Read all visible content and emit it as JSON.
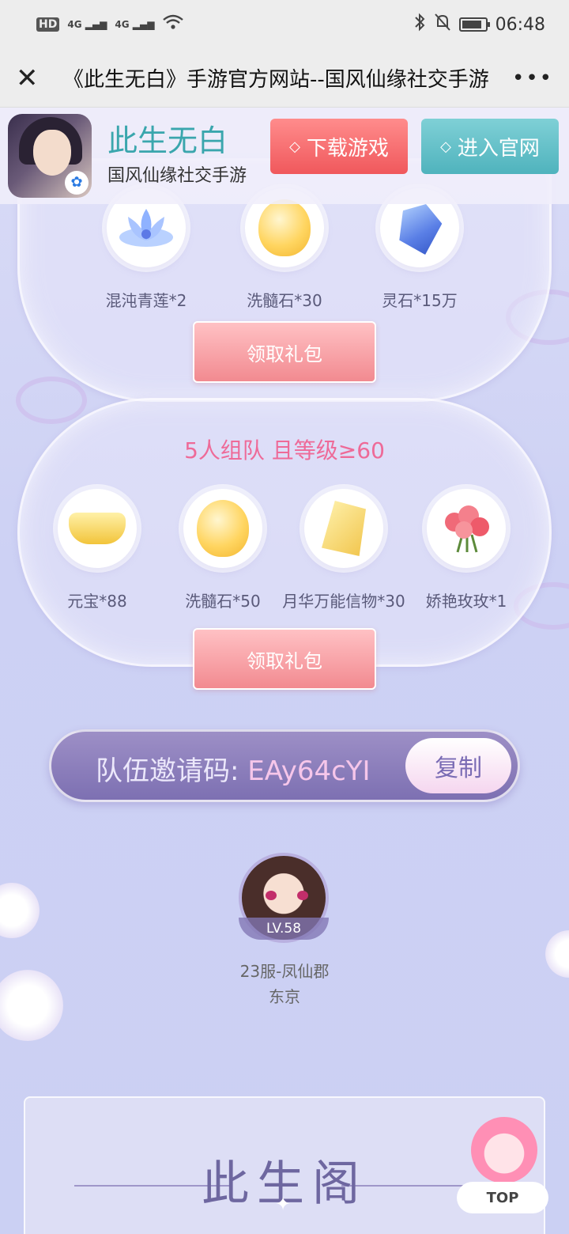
{
  "status_bar": {
    "hd": "HD",
    "net1": "4G",
    "net2": "4G",
    "time": "06:48",
    "battery_level": 0.85
  },
  "browser": {
    "title": "《此生无白》手游官方网站--国风仙缘社交手游",
    "close_glyph": "✕",
    "more_glyph": "•••"
  },
  "banner": {
    "app_name": "此生无白",
    "app_subtitle": "国风仙缘社交手游",
    "download_label": "下载游戏",
    "official_label": "进入官网",
    "diamond_glyph": "◇"
  },
  "panel1": {
    "items": [
      {
        "label": "混沌青莲*2",
        "icon": "blue-lotus-icon"
      },
      {
        "label": "洗髓石*30",
        "icon": "golden-stone-icon"
      },
      {
        "label": "灵石*15万",
        "icon": "spirit-crystal-icon"
      }
    ],
    "claim_label": "领取礼包"
  },
  "panel2": {
    "title": "5人组队 且等级≥60",
    "items": [
      {
        "label": "元宝*88",
        "icon": "gold-ingot-icon"
      },
      {
        "label": "洗髓石*50",
        "icon": "golden-stone-icon"
      },
      {
        "label": "月华万能信物*30",
        "icon": "moon-token-icon"
      },
      {
        "label": "娇艳玫玫*1",
        "icon": "rose-bouquet-icon"
      }
    ],
    "claim_label": "领取礼包"
  },
  "invite": {
    "label": "队伍邀请码:",
    "code": "EAy64cYI",
    "copy_label": "复制"
  },
  "player": {
    "level": "LV.58",
    "server": "23服-凤仙郡",
    "city": "东京"
  },
  "bottom": {
    "title": "此生阁",
    "top_label": "TOP"
  },
  "colors": {
    "accent_pink": "#ee6a98",
    "app_name_teal": "#3aa6ad",
    "download_red": "#f0585c",
    "official_teal": "#4fb3bd",
    "invite_purple": "#7d70b2"
  }
}
